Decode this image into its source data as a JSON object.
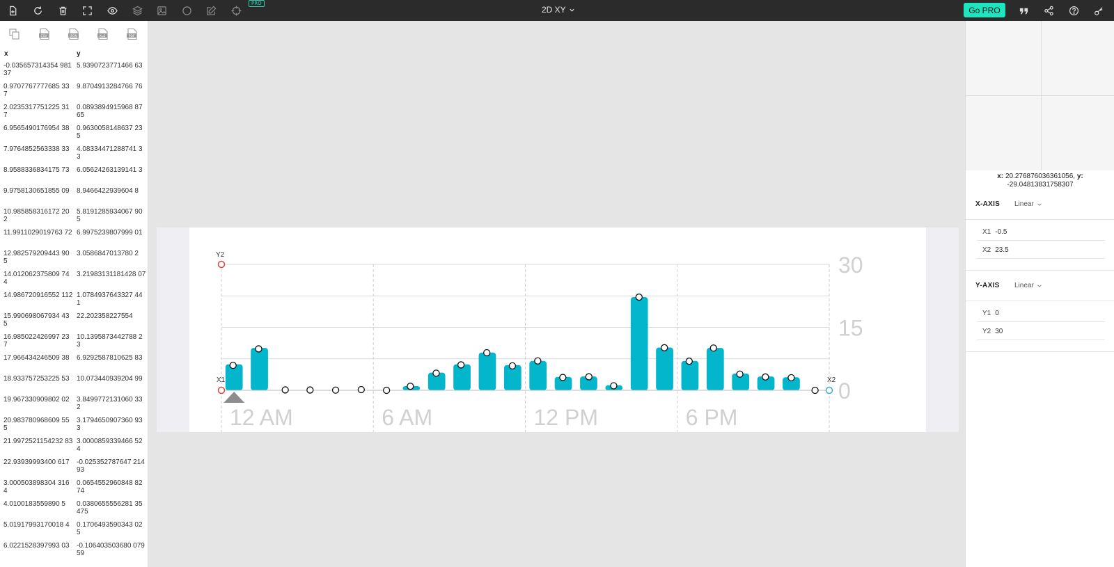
{
  "toolbar": {
    "icons": [
      "new-file-icon",
      "refresh-icon",
      "trash-icon",
      "fullscreen-icon",
      "eye-icon",
      "layers-icon",
      "image-icon",
      "circle-icon",
      "edit-icon",
      "target-icon"
    ],
    "pro_tag": "PRO",
    "mode_label": "2D XY",
    "go_pro_label": "Go PRO",
    "right_icons": [
      "quote-icon",
      "share-icon",
      "help-icon",
      "key-icon"
    ]
  },
  "export": {
    "icons": [
      "copy-icon",
      "csv-icon",
      "json-icon",
      "xls-icon",
      "pdf-icon"
    ],
    "csv": "CSV",
    "json": "JSON",
    "xls": "XLS",
    "pdf": "PDF"
  },
  "table": {
    "x_header": "x",
    "y_header": "y",
    "rows": [
      {
        "x": "-0.035657314354 98137",
        "y": "5.9390723771466 63"
      },
      {
        "x": "0.9707767777685 337",
        "y": "9.8704913284766 76"
      },
      {
        "x": "2.0235317751225 317",
        "y": "0.0893894915968 8765"
      },
      {
        "x": "6.9565490176954 38",
        "y": "0.9630058148637 235"
      },
      {
        "x": "7.9764852563338 33",
        "y": "4.08334471288741 33"
      },
      {
        "x": "8.9588336834175 73",
        "y": "6.05624263139141 3"
      },
      {
        "x": "9.9758130651855 09",
        "y": "8.9466422939604 8"
      },
      {
        "x": "10.985858316172 202",
        "y": "5.8191285934067 905"
      },
      {
        "x": "11.9911029019763 72",
        "y": "6.9975239807999 01"
      },
      {
        "x": "12.982579209443 905",
        "y": "3.0586847013780 2"
      },
      {
        "x": "14.012062375809 744",
        "y": "3.21983131181428 07"
      },
      {
        "x": "14.986720916552 112",
        "y": "1.0784937643327 441"
      },
      {
        "x": "15.990698067934 435",
        "y": "22.202358227554"
      },
      {
        "x": "16.985022426997 237",
        "y": "10.1395873442788 23"
      },
      {
        "x": "17.966434246509 38",
        "y": "6.9292587810625 83"
      },
      {
        "x": "18.933757253225 53",
        "y": "10.073440939204 99"
      },
      {
        "x": "19.967330909802 02",
        "y": "3.8499772131060 332"
      },
      {
        "x": "20.983780968609 555",
        "y": "3.1794650907360 933"
      },
      {
        "x": "21.9972521154232 83",
        "y": "3.0000859339466 524"
      },
      {
        "x": "22.93939993400 617",
        "y": "-0.025352787647 21493"
      },
      {
        "x": "3.000503898304 3164",
        "y": "0.0654552960848 8274"
      },
      {
        "x": "4.0100183559890 5",
        "y": "0.0380655556281 35475"
      },
      {
        "x": "5.01917993170018 4",
        "y": "0.1706493590343 025"
      },
      {
        "x": "6.0221528397993 03",
        "y": "-0.106403503680 07959"
      }
    ]
  },
  "chart_data": {
    "type": "bar",
    "x": [
      0,
      1,
      2,
      3,
      4,
      5,
      6,
      7,
      8,
      9,
      10,
      11,
      12,
      13,
      14,
      15,
      16,
      17,
      18,
      19,
      20,
      21,
      22,
      23
    ],
    "values": [
      6.2,
      10.1,
      0,
      0,
      0,
      0,
      0,
      1.0,
      4.2,
      6.2,
      9.0,
      6.0,
      7.0,
      3.2,
      3.3,
      1.2,
      22.2,
      10.2,
      7.0,
      10.1,
      4.0,
      3.3,
      3.1,
      0
    ],
    "points": [
      [
        -0.04,
        5.94
      ],
      [
        0.97,
        9.87
      ],
      [
        2.02,
        0.09
      ],
      [
        3.0,
        0.07
      ],
      [
        4.01,
        0.04
      ],
      [
        5.02,
        0.17
      ],
      [
        6.02,
        -0.11
      ],
      [
        6.96,
        0.96
      ],
      [
        7.98,
        4.08
      ],
      [
        8.96,
        6.06
      ],
      [
        9.98,
        8.95
      ],
      [
        10.99,
        5.82
      ],
      [
        11.99,
        7.0
      ],
      [
        12.98,
        3.06
      ],
      [
        14.01,
        3.22
      ],
      [
        14.99,
        1.08
      ],
      [
        15.99,
        22.2
      ],
      [
        16.99,
        10.14
      ],
      [
        17.97,
        6.93
      ],
      [
        18.93,
        10.07
      ],
      [
        19.97,
        3.85
      ],
      [
        20.98,
        3.18
      ],
      [
        22.0,
        3.0
      ],
      [
        22.94,
        -0.03
      ]
    ],
    "x_tick_labels": [
      "12 AM",
      "6 AM",
      "12 PM",
      "6 PM"
    ],
    "x_tick_values": [
      0,
      6,
      12,
      18
    ],
    "y_tick_labels": [
      "30",
      "15",
      "0"
    ],
    "y_tick_values": [
      30,
      15,
      0
    ],
    "xlim": [
      -0.5,
      23.5
    ],
    "ylim": [
      0,
      30
    ],
    "bar_color": "#04b6cc",
    "grid": true,
    "markers": {
      "y2": "Y2",
      "x1": "X1",
      "x2": "X2"
    },
    "marker_colors": {
      "red": "#e0453a",
      "blue": "#3da8e0"
    }
  },
  "coords": {
    "x_label": "x:",
    "x_value": "20.276876036361056,",
    "y_label": "y:",
    "y_value": "-29.04813831758307"
  },
  "x_axis": {
    "title": "X-AXIS",
    "type": "Linear",
    "x1_label": "X1",
    "x1_value": "-0.5",
    "x2_label": "X2",
    "x2_value": "23.5"
  },
  "y_axis": {
    "title": "Y-AXIS",
    "type": "Linear",
    "y1_label": "Y1",
    "y1_value": "0",
    "y2_label": "Y2",
    "y2_value": "30"
  }
}
